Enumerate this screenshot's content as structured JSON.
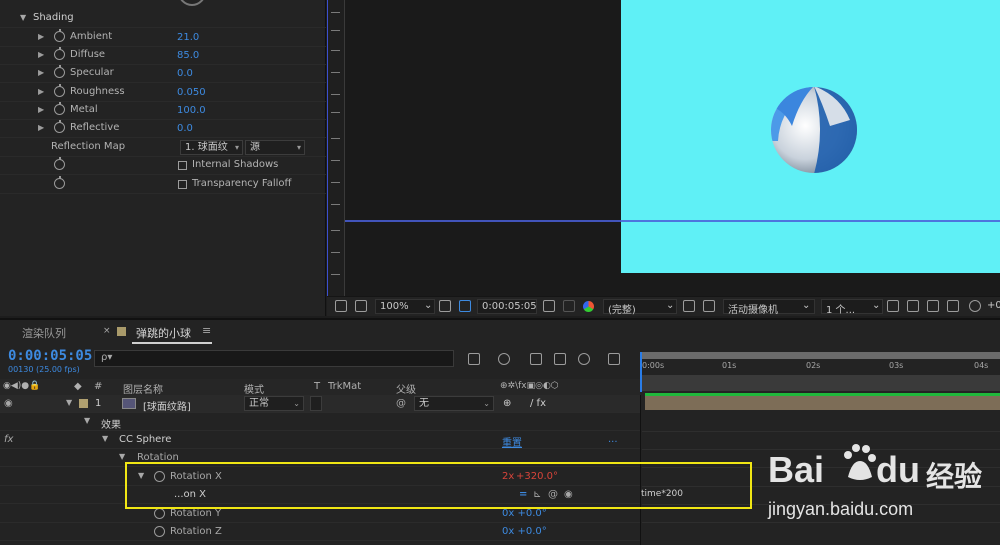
{
  "effect_controls": {
    "section": "Shading",
    "properties": [
      {
        "label": "Ambient",
        "value": "21.0"
      },
      {
        "label": "Diffuse",
        "value": "85.0"
      },
      {
        "label": "Specular",
        "value": "0.0"
      },
      {
        "label": "Roughness",
        "value": "0.050"
      },
      {
        "label": "Metal",
        "value": "100.0"
      },
      {
        "label": "Reflective",
        "value": "0.0"
      }
    ],
    "reflection_map": {
      "label": "Reflection Map",
      "layer": "1. 球面纹",
      "source": "源"
    },
    "internal_shadows": "Internal Shadows",
    "transparency_falloff": "Transparency Falloff"
  },
  "viewer_toolbar": {
    "zoom": "100%",
    "timecode": "0:00:05:05",
    "resolution": "(完整)",
    "camera": "活动摄像机",
    "views": "1 个...",
    "plus": "+0"
  },
  "timeline": {
    "tabs": [
      {
        "label": "渲染队列"
      },
      {
        "label": "弹跳的小球"
      }
    ],
    "timecode": "0:00:05:05",
    "frame_info": "00130 (25.00 fps)",
    "search_placeholder": "ρ▾",
    "columns": {
      "num": "#",
      "layer_name": "图层名称",
      "mode": "模式",
      "t": "T",
      "trkmat": "TrkMat",
      "parent": "父级"
    },
    "layer": {
      "index": "1",
      "name": "[球面纹路]",
      "mode": "正常",
      "parent": "无"
    },
    "effects_label": "效果",
    "fx_label": "fx",
    "effect_name": "CC Sphere",
    "reset": "重置",
    "ellipsis": "...",
    "rotation_group": "Rotation",
    "rotation_x": {
      "label": "Rotation X",
      "value_rev": "2x",
      "value_deg": "+320.0°"
    },
    "expression_label": "...on X",
    "expression": "time*200",
    "rotation_y": {
      "label": "Rotation Y",
      "value": "0x +0.0°"
    },
    "rotation_z": {
      "label": "Rotation Z",
      "value": "0x +0.0°"
    },
    "ruler": [
      "0:00s",
      "01s",
      "02s",
      "03s",
      "04s"
    ]
  },
  "watermark": {
    "brand": "Bai",
    "brand2": "du",
    "cn": "经验",
    "url": "jingyan.baidu.com"
  },
  "colors": {
    "accent": "#3d8ae0",
    "canvas": "#5ff0f6",
    "highlight": "#f0e614",
    "red_value": "#d7443a"
  }
}
